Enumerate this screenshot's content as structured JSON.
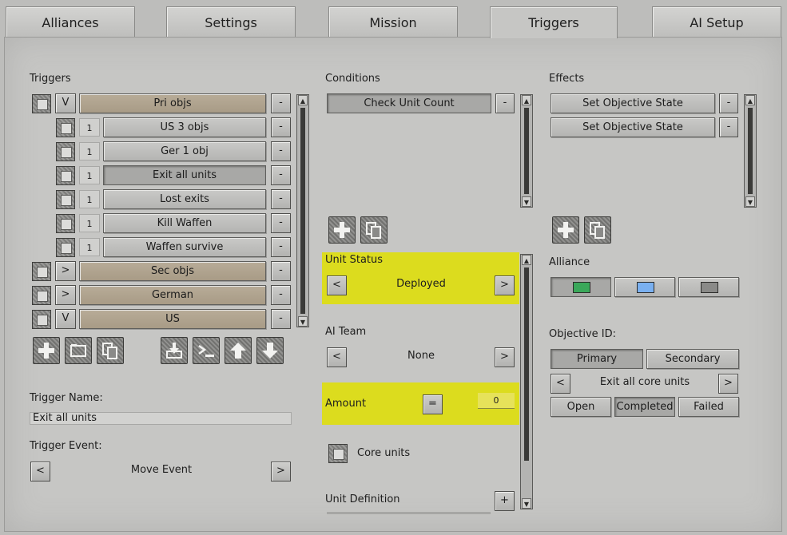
{
  "tabs": [
    "Alliances",
    "Settings",
    "Mission",
    "Triggers",
    "AI Setup"
  ],
  "active_tab": "Triggers",
  "triggers": {
    "heading": "Triggers",
    "rows": [
      {
        "toggle": "V",
        "name": "Pri objs",
        "del": "-"
      },
      {
        "num": "1",
        "name": "US 3 objs",
        "del": "-"
      },
      {
        "num": "1",
        "name": "Ger 1 obj",
        "del": "-"
      },
      {
        "num": "1",
        "name": "Exit all units",
        "del": "-"
      },
      {
        "num": "1",
        "name": "Lost exits",
        "del": "-"
      },
      {
        "num": "1",
        "name": "Kill Waffen",
        "del": "-"
      },
      {
        "num": "1",
        "name": "Waffen survive",
        "del": "-"
      },
      {
        "toggle": ">",
        "name": "Sec objs",
        "del": "-"
      },
      {
        "toggle": ">",
        "name": "German",
        "del": "-"
      },
      {
        "toggle": "V",
        "name": "US",
        "del": "-"
      }
    ],
    "toolbar_icons": [
      "plus-icon",
      "folder-icon",
      "copy-icon",
      "import-icon",
      "console-icon",
      "arrow-up-icon",
      "arrow-down-icon"
    ],
    "name_label": "Trigger Name:",
    "name_value": "Exit all units",
    "event_label": "Trigger Event:",
    "event_value": "Move Event",
    "event_prev": "<",
    "event_next": ">"
  },
  "conditions": {
    "heading": "Conditions",
    "items": [
      {
        "name": "Check Unit Count",
        "del": "-"
      }
    ],
    "unit_status_label": "Unit Status",
    "unit_status_value": "Deployed",
    "ai_team_label": "AI Team",
    "ai_team_value": "None",
    "amount_label": "Amount",
    "amount_operator": "=",
    "amount_value": "0",
    "core_units_label": "Core units",
    "unit_definition_label": "Unit Definition",
    "unit_definition_add": "+",
    "prev": "<",
    "next": ">"
  },
  "effects": {
    "heading": "Effects",
    "items": [
      {
        "name": "Set Objective State",
        "del": "-"
      },
      {
        "name": "Set Objective State",
        "del": "-"
      }
    ],
    "alliance_label": "Alliance",
    "alliance_colors": [
      "#3aa85a",
      "#7ab0f0",
      "#8a8a88"
    ],
    "objective_label": "Objective ID:",
    "objective_types": [
      "Primary",
      "Secondary"
    ],
    "objective_value": "Exit all core units",
    "states": [
      "Open",
      "Completed",
      "Failed"
    ],
    "prev": "<",
    "next": ">"
  },
  "colors": {
    "highlight": "#dcdc1e",
    "tan": "#b0a38e"
  }
}
